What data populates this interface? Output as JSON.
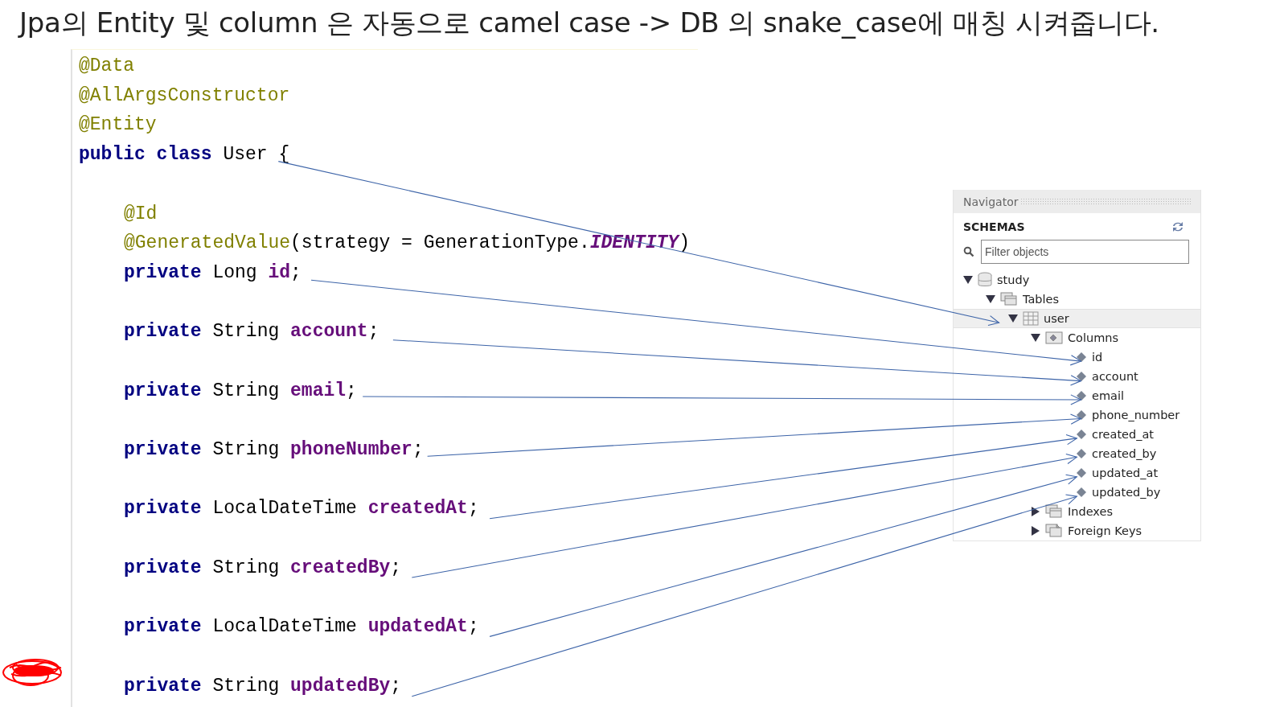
{
  "title": "Jpa의 Entity 및 column 은 자동으로 camel case -> DB 의 snake_case에 매칭 시켜줍니다.",
  "code": {
    "lines": [
      {
        "indented": false,
        "gap_before": false,
        "tokens": [
          {
            "text": "@Data",
            "kind": "annotation"
          }
        ]
      },
      {
        "indented": false,
        "gap_before": false,
        "tokens": [
          {
            "text": "@AllArgsConstructor",
            "kind": "annotation"
          }
        ]
      },
      {
        "indented": false,
        "gap_before": false,
        "tokens": [
          {
            "text": "@Entity",
            "kind": "annotation"
          }
        ]
      },
      {
        "indented": false,
        "gap_before": false,
        "tokens": [
          {
            "text": "public class ",
            "kind": "keyword"
          },
          {
            "text": "User {",
            "kind": "plain"
          }
        ]
      },
      {
        "indented": true,
        "gap_before": true,
        "tokens": [
          {
            "text": "@Id",
            "kind": "annotation"
          }
        ]
      },
      {
        "indented": true,
        "gap_before": false,
        "tokens": [
          {
            "text": "@GeneratedValue",
            "kind": "annotation"
          },
          {
            "text": "(strategy = GenerationType.",
            "kind": "plain"
          },
          {
            "text": "IDENTITY",
            "kind": "constant"
          },
          {
            "text": ")",
            "kind": "plain"
          }
        ]
      },
      {
        "indented": true,
        "gap_before": false,
        "tokens": [
          {
            "text": "private ",
            "kind": "keyword"
          },
          {
            "text": "Long ",
            "kind": "plain"
          },
          {
            "text": "id",
            "kind": "field"
          },
          {
            "text": ";",
            "kind": "plain"
          }
        ]
      },
      {
        "indented": true,
        "gap_before": true,
        "tokens": [
          {
            "text": "private ",
            "kind": "keyword"
          },
          {
            "text": "String ",
            "kind": "plain"
          },
          {
            "text": "account",
            "kind": "field"
          },
          {
            "text": ";",
            "kind": "plain"
          }
        ]
      },
      {
        "indented": true,
        "gap_before": true,
        "tokens": [
          {
            "text": "private ",
            "kind": "keyword"
          },
          {
            "text": "String ",
            "kind": "plain"
          },
          {
            "text": "email",
            "kind": "field"
          },
          {
            "text": ";",
            "kind": "plain"
          }
        ]
      },
      {
        "indented": true,
        "gap_before": true,
        "tokens": [
          {
            "text": "private ",
            "kind": "keyword"
          },
          {
            "text": "String ",
            "kind": "plain"
          },
          {
            "text": "phoneNumber",
            "kind": "field"
          },
          {
            "text": ";",
            "kind": "plain"
          }
        ]
      },
      {
        "indented": true,
        "gap_before": true,
        "tokens": [
          {
            "text": "private ",
            "kind": "keyword"
          },
          {
            "text": "LocalDateTime ",
            "kind": "plain"
          },
          {
            "text": "createdAt",
            "kind": "field"
          },
          {
            "text": ";",
            "kind": "plain"
          }
        ]
      },
      {
        "indented": true,
        "gap_before": true,
        "tokens": [
          {
            "text": "private ",
            "kind": "keyword"
          },
          {
            "text": "String ",
            "kind": "plain"
          },
          {
            "text": "createdBy",
            "kind": "field"
          },
          {
            "text": ";",
            "kind": "plain"
          }
        ]
      },
      {
        "indented": true,
        "gap_before": true,
        "tokens": [
          {
            "text": "private ",
            "kind": "keyword"
          },
          {
            "text": "LocalDateTime ",
            "kind": "plain"
          },
          {
            "text": "updatedAt",
            "kind": "field"
          },
          {
            "text": ";",
            "kind": "plain"
          }
        ]
      },
      {
        "indented": true,
        "gap_before": true,
        "tokens": [
          {
            "text": "private ",
            "kind": "keyword"
          },
          {
            "text": "String ",
            "kind": "plain"
          },
          {
            "text": "updatedBy",
            "kind": "field"
          },
          {
            "text": ";",
            "kind": "plain"
          }
        ]
      }
    ]
  },
  "navigator": {
    "title": "Navigator",
    "section": "SCHEMAS",
    "filter": {
      "placeholder": "Filter objects"
    },
    "tree": [
      {
        "label": "study",
        "kind": "database",
        "expanded": true,
        "selected": false,
        "children": [
          {
            "label": "Tables",
            "kind": "group",
            "expanded": true,
            "selected": false,
            "children": [
              {
                "label": "user",
                "kind": "table",
                "expanded": true,
                "selected": true,
                "children": [
                  {
                    "label": "Columns",
                    "kind": "columns",
                    "expanded": true,
                    "selected": false,
                    "children": [
                      {
                        "label": "id",
                        "kind": "column",
                        "selected": false
                      },
                      {
                        "label": "account",
                        "kind": "column",
                        "selected": false
                      },
                      {
                        "label": "email",
                        "kind": "column",
                        "selected": false
                      },
                      {
                        "label": "phone_number",
                        "kind": "column",
                        "selected": false
                      },
                      {
                        "label": "created_at",
                        "kind": "column",
                        "selected": false
                      },
                      {
                        "label": "created_by",
                        "kind": "column",
                        "selected": false
                      },
                      {
                        "label": "updated_at",
                        "kind": "column",
                        "selected": false
                      },
                      {
                        "label": "updated_by",
                        "kind": "column",
                        "selected": false
                      }
                    ]
                  },
                  {
                    "label": "Indexes",
                    "kind": "group",
                    "expanded": false,
                    "selected": false
                  },
                  {
                    "label": "Foreign Keys",
                    "kind": "keys",
                    "expanded": false,
                    "selected": false
                  }
                ]
              }
            ]
          }
        ]
      }
    ]
  }
}
